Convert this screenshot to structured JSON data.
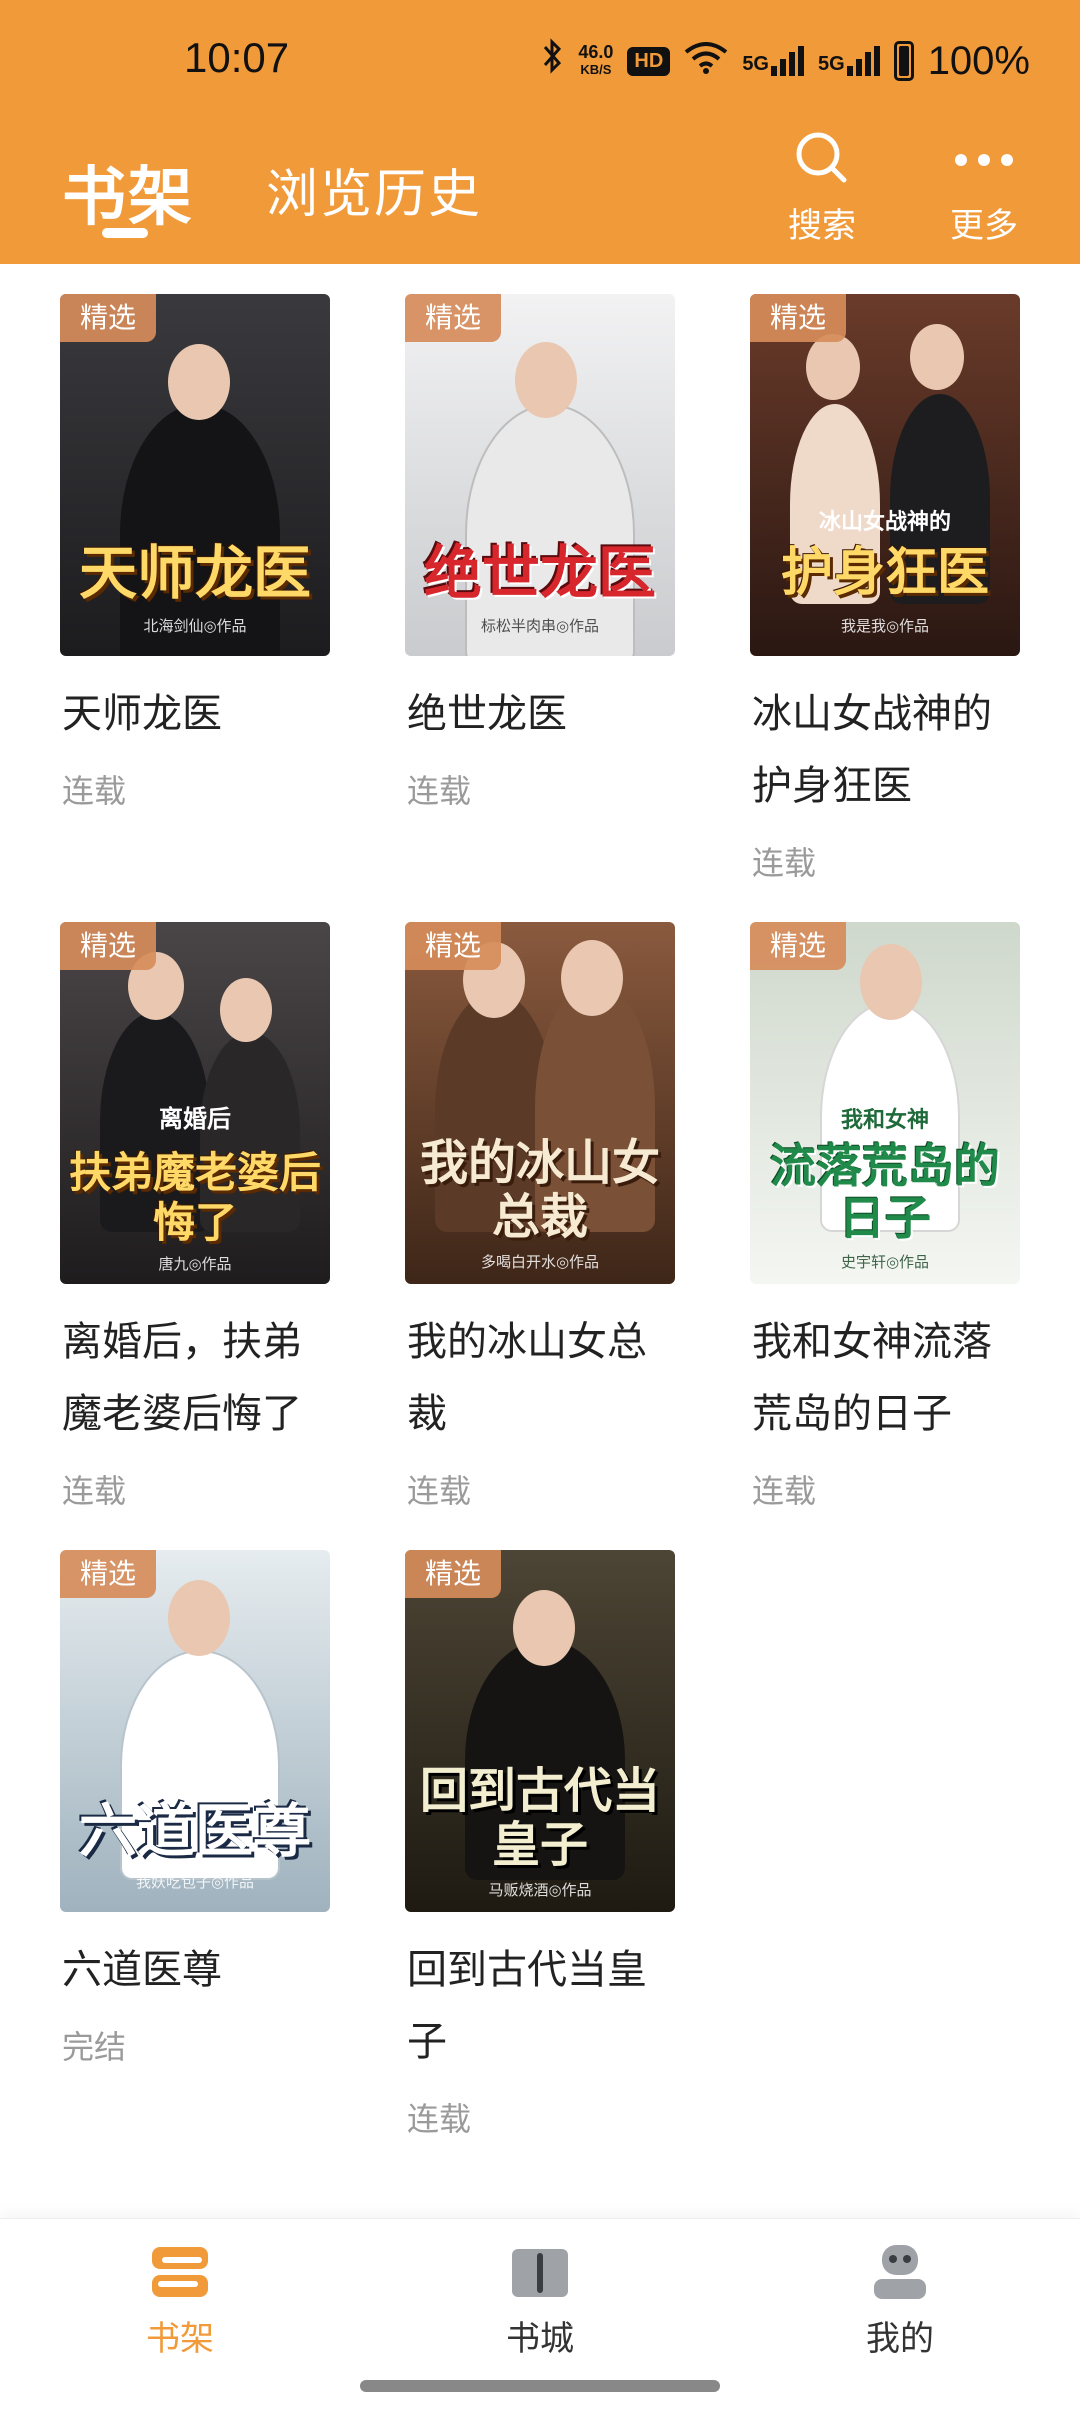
{
  "status_bar": {
    "time": "10:07",
    "net_speed_value": "46.0",
    "net_speed_unit": "KB/S",
    "hd_label": "HD",
    "sim1": "5G",
    "sim2": "5G",
    "battery": "100%"
  },
  "header": {
    "tabs": [
      {
        "label": "书架",
        "active": true
      },
      {
        "label": "浏览历史",
        "active": false
      }
    ],
    "search_label": "搜索",
    "more_label": "更多",
    "color": "#f19a3a"
  },
  "books": [
    {
      "name": "天师龙医",
      "status": "连载",
      "badge": "精选",
      "cover_title": "天师龙医",
      "cover_author": "北海剑仙◎作品",
      "cover_bg": "#2b2b2e",
      "accent": "#d8a64a"
    },
    {
      "name": "绝世龙医",
      "status": "连载",
      "badge": "精选",
      "cover_title": "绝世龙医",
      "cover_author": "标松半肉串◎作品",
      "cover_bg": "#dfe0e2",
      "accent": "#c0272d"
    },
    {
      "name": "冰山女战神的护身狂医",
      "status": "连载",
      "badge": "精选",
      "cover_title": "护身狂医",
      "cover_subtitle": "冰山女战神的",
      "cover_author": "我是我◎作品",
      "cover_bg": "#4a2a22",
      "accent": "#e8c058"
    },
    {
      "name": "离婚后，扶弟魔老婆后悔了",
      "status": "连载",
      "badge": "精选",
      "cover_title": "扶弟魔老婆后悔了",
      "cover_subtitle": "离婚后",
      "cover_author": "唐九◎作品",
      "cover_bg": "#2e2a2c",
      "accent": "#e8b14a"
    },
    {
      "name": "我的冰山女总裁",
      "status": "连载",
      "badge": "精选",
      "cover_title": "我的冰山女总裁",
      "cover_author": "多喝白开水◎作品",
      "cover_bg": "#6b4632",
      "accent": "#f4e3c8"
    },
    {
      "name": "我和女神流落荒岛的日子",
      "status": "连载",
      "badge": "精选",
      "cover_title": "流落荒岛的日子",
      "cover_subtitle": "我和女神",
      "cover_author": "史宇轩◎作品",
      "cover_bg": "#e8eee6",
      "accent": "#2e8a4a"
    },
    {
      "name": "六道医尊",
      "status": "完结",
      "badge": "精选",
      "cover_title": "六道医尊",
      "cover_author": "我妖吃包子◎作品",
      "cover_bg": "#c9d6de",
      "accent": "#ffffff"
    },
    {
      "name": "回到古代当皇子",
      "status": "连载",
      "badge": "精选",
      "cover_title": "回到古代当皇子",
      "cover_author": "马贩烧酒◎作品",
      "cover_bg": "#3b3426",
      "accent": "#f3eecf"
    }
  ],
  "bottom_nav": [
    {
      "label": "书架",
      "icon": "shelf-icon",
      "active": true
    },
    {
      "label": "书城",
      "icon": "book-store-icon",
      "active": false
    },
    {
      "label": "我的",
      "icon": "profile-icon",
      "active": false
    }
  ]
}
